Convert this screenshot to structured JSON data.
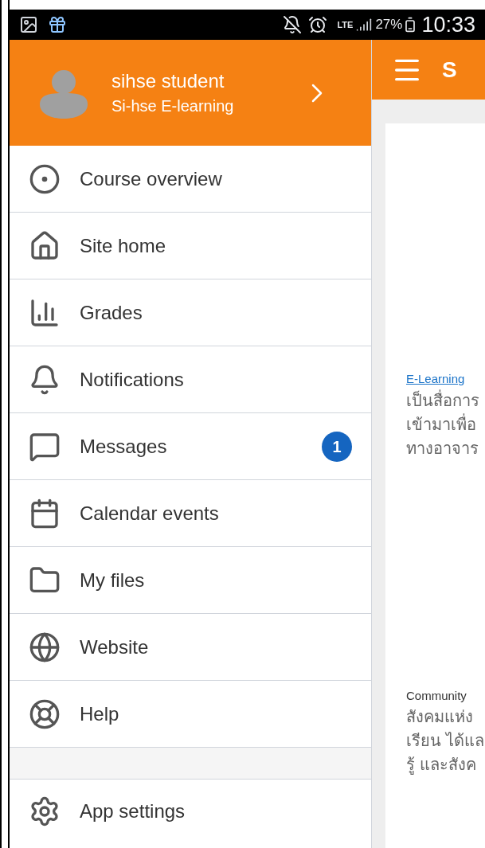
{
  "status_bar": {
    "network": "LTE",
    "battery": "27%",
    "time": "10:33"
  },
  "drawer": {
    "user_name": "sihse student",
    "site_name": "Si-hse E-learning",
    "items": [
      {
        "label": "Course overview"
      },
      {
        "label": "Site home"
      },
      {
        "label": "Grades"
      },
      {
        "label": "Notifications"
      },
      {
        "label": "Messages",
        "badge": "1"
      },
      {
        "label": "Calendar events"
      },
      {
        "label": "My files"
      },
      {
        "label": "Website"
      },
      {
        "label": "Help"
      }
    ],
    "footer_items": [
      {
        "label": "App settings"
      }
    ]
  },
  "app_bar": {
    "title": "S"
  },
  "content": {
    "sections": [
      {
        "heading": "E-Learning",
        "kind": "link",
        "lines": [
          "เป็นสื่อการ",
          "เข้ามาเพื่อ",
          "ทางอาจาร"
        ]
      },
      {
        "heading": "Community",
        "kind": "plain",
        "lines": [
          "สังคมแห่ง",
          "เรียน ได้แล",
          "รู้ และสังค"
        ]
      }
    ]
  }
}
